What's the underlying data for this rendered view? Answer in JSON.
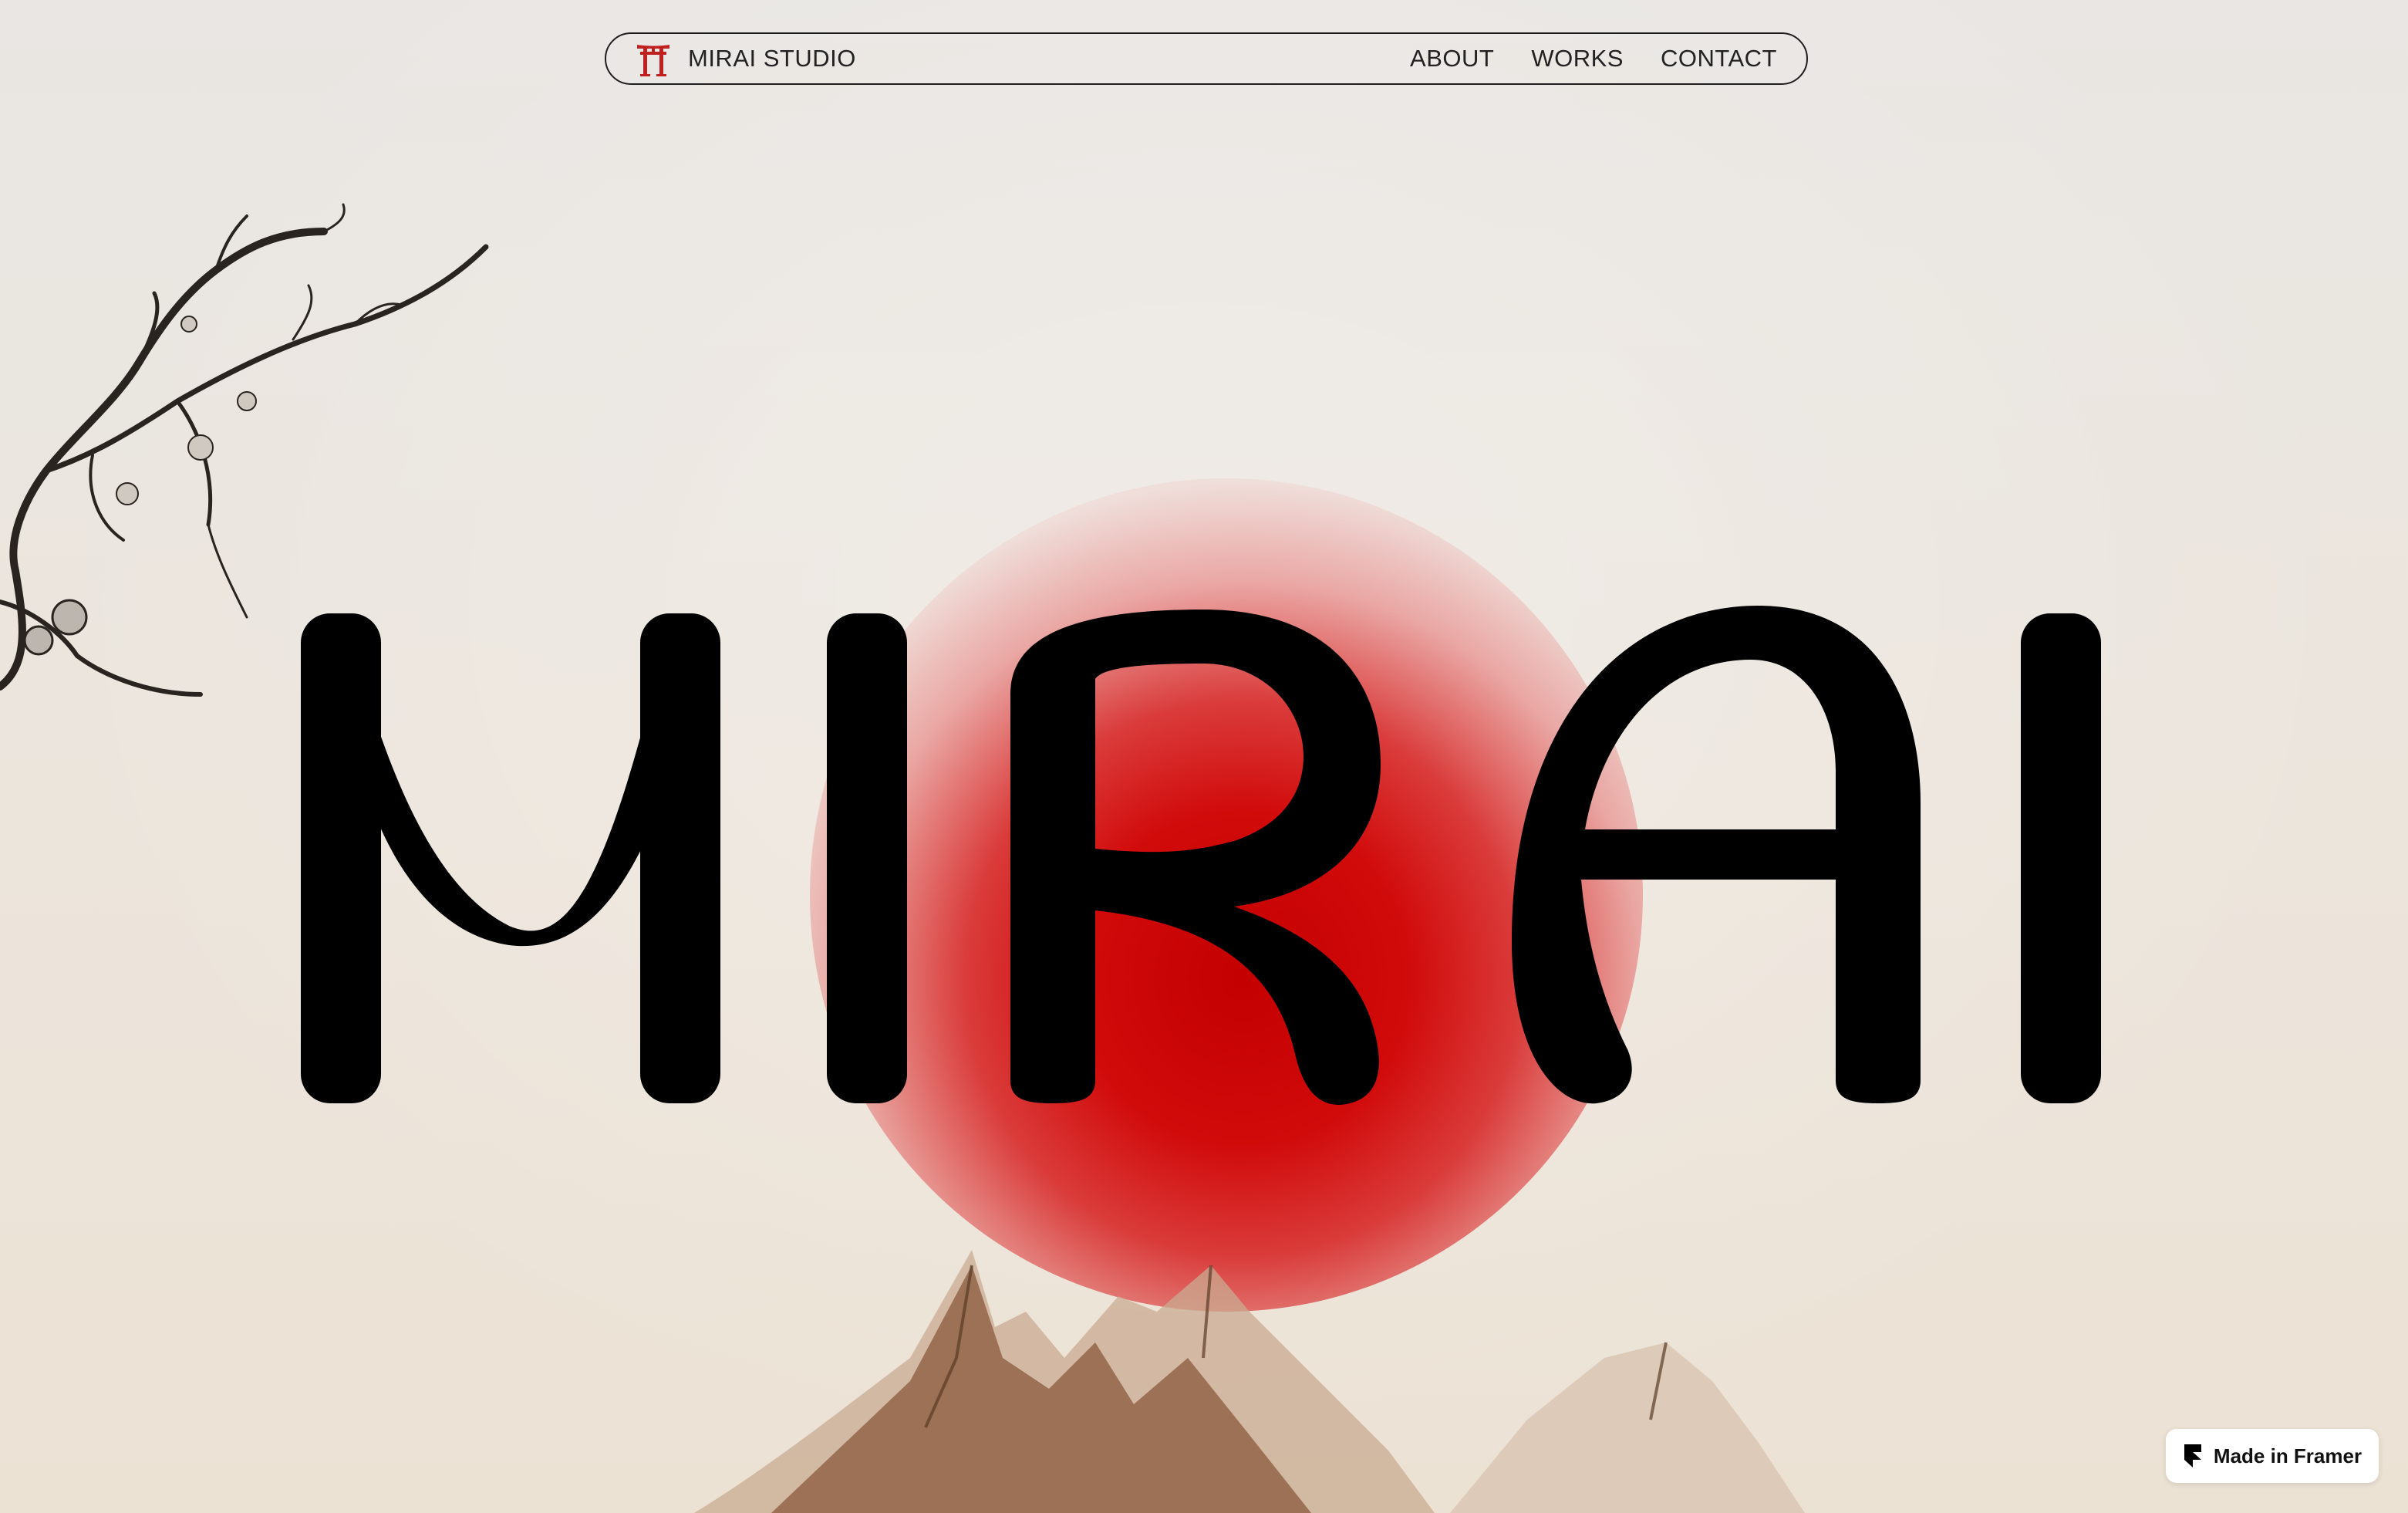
{
  "nav": {
    "brand": "MIRAI STUDIO",
    "links": [
      "ABOUT",
      "WORKS",
      "CONTACT"
    ]
  },
  "hero": {
    "title": "MIRAI"
  },
  "badge": {
    "label": "Made in Framer"
  },
  "colors": {
    "accent_red": "#c40000",
    "background": "#ebe6e0",
    "ink": "#000000"
  },
  "icons": [
    "torii-gate-icon",
    "framer-icon"
  ]
}
